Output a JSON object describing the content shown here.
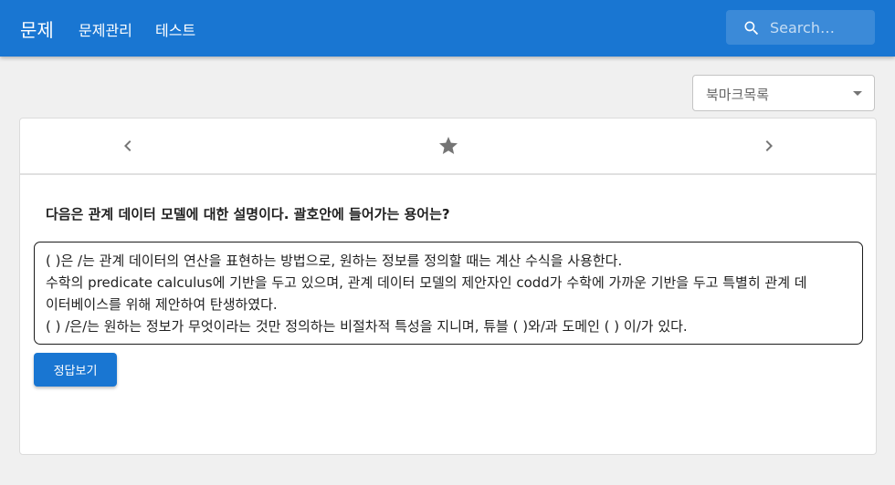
{
  "header": {
    "brand": "문제",
    "nav": [
      "문제관리",
      "테스트"
    ],
    "search": {
      "placeholder": "Search…",
      "icon": "search-icon"
    }
  },
  "bookmark_select": {
    "value": "북마크목록"
  },
  "card": {
    "nav": {
      "prev_icon": "chevron-left-icon",
      "bookmark_icon": "star-icon",
      "next_icon": "chevron-right-icon"
    },
    "question": "다음은 관계 데이터 모델에 대한 설명이다. 괄호안에 들어가는 용어는?",
    "description_lines": [
      "( )은 /는 관계 데이터의 연산을 표현하는 방법으로, 원하는 정보를 정의할 때는 계산 수식을 사용한다.",
      "수학의 predicate calculus에 기반을 두고 있으며, 관계 데이터 모델의 제안자인 codd가 수학에 가까운 기반을 두고 특별히 관계 데",
      "이터베이스를 위해 제안하여 탄생하였다.",
      "( ) /은/는 원하는 정보가 무엇이라는 것만 정의하는 비절차적 특성을 지니며, 튜블 ( )와/과 도메인 ( ) 이/가 있다."
    ],
    "answer_button": "정답보기"
  },
  "colors": {
    "primary": "#1976d2",
    "background": "#f0f0f0",
    "icon_gray": "#757575"
  }
}
